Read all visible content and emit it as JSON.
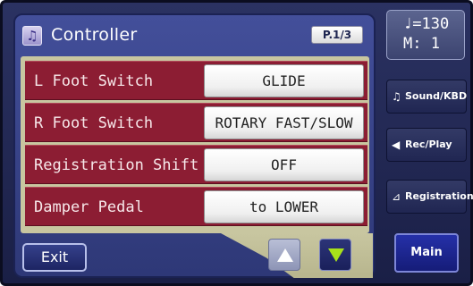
{
  "window": {
    "title": "Controller",
    "page_indicator": "P.1/3",
    "title_icon": "music-note-icon"
  },
  "parameters": [
    {
      "label": "L Foot Switch",
      "value": "GLIDE"
    },
    {
      "label": "R Foot Switch",
      "value": "ROTARY FAST/SLOW"
    },
    {
      "label": "Registration Shift",
      "value": "OFF"
    },
    {
      "label": "Damper Pedal",
      "value": "to LOWER"
    }
  ],
  "footer": {
    "exit_label": "Exit",
    "scroll_up_icon": "up-arrow-icon",
    "scroll_down_icon": "down-arrow-icon"
  },
  "tempo": {
    "line1": "♩=130",
    "line2": "M:  1"
  },
  "side_buttons": [
    {
      "label": "Sound/KBD",
      "icon": "music-note-icon",
      "glyph": "♫"
    },
    {
      "label": "Rec/Play",
      "icon": "speaker-icon",
      "glyph": "◀"
    },
    {
      "label": "Registration",
      "icon": "registration-icon",
      "glyph": "⊿"
    }
  ],
  "main_button_label": "Main",
  "colors": {
    "row_background": "#8c1d33",
    "panel_background": "#3a4590",
    "down_arrow": "#a8e01a"
  }
}
